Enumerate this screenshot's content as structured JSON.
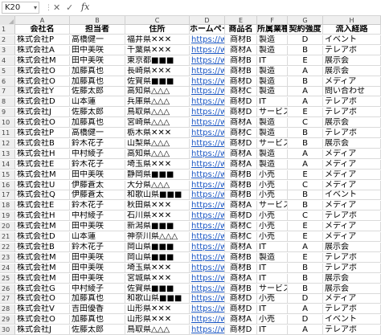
{
  "formula_bar": {
    "name_box": "K20",
    "cancel_icon": "✕",
    "enter_icon": "✓",
    "fx": "fx",
    "value": ""
  },
  "columns": [
    "A",
    "B",
    "C",
    "D",
    "E",
    "F",
    "G",
    "H"
  ],
  "header_row": [
    "会社名",
    "担当者",
    "住所",
    "ホームページ",
    "商品名",
    "所属業種",
    "契約強度",
    "流入経路"
  ],
  "rows": [
    [
      "株式会社P",
      "高橋健一",
      "福井県✕✕✕",
      "https://ww",
      "商材B",
      "製造",
      "D",
      "イベント"
    ],
    [
      "株式会社A",
      "田中美咲",
      "千葉県✕✕✕",
      "https://ww",
      "商材A",
      "製造",
      "B",
      "テレアポ"
    ],
    [
      "株式会社M",
      "田中美咲",
      "東京都■■■",
      "https://ww",
      "商材B",
      "IT",
      "E",
      "展示会"
    ],
    [
      "株式会社O",
      "加藤真也",
      "長崎県✕✕✕",
      "https://ww",
      "商材B",
      "製造",
      "A",
      "展示会"
    ],
    [
      "株式会社O",
      "加藤真也",
      "佐賀県■■■",
      "https://ww",
      "商材D",
      "製造",
      "B",
      "メディア"
    ],
    [
      "株式会社Y",
      "佐藤太郎",
      "高知県△△△",
      "https://ww",
      "商材C",
      "製造",
      "A",
      "問い合わせ"
    ],
    [
      "株式会社D",
      "山本蓮",
      "兵庫県△△△",
      "https://ww",
      "商材D",
      "IT",
      "A",
      "テレアポ"
    ],
    [
      "株式会社J",
      "佐藤太郎",
      "鳥取県△△△",
      "https://ww",
      "商材D",
      "サービス",
      "E",
      "テレアポ"
    ],
    [
      "株式会社O",
      "加藤真也",
      "宮崎県△△△",
      "https://ww",
      "商材A",
      "製造",
      "C",
      "展示会"
    ],
    [
      "株式会社P",
      "高橋健一",
      "栃木県✕✕✕",
      "https://ww",
      "商材C",
      "製造",
      "B",
      "テレアポ"
    ],
    [
      "株式会社B",
      "鈴木花子",
      "山梨県△△△",
      "https://ww",
      "商材D",
      "サービス",
      "B",
      "展示会"
    ],
    [
      "株式会社H",
      "中村綾子",
      "高知県△△△",
      "https://ww",
      "商材A",
      "製造",
      "A",
      "メディア"
    ],
    [
      "株式会社E",
      "鈴木花子",
      "埼玉県✕✕✕",
      "https://ww",
      "商材A",
      "製造",
      "A",
      "メディア"
    ],
    [
      "株式会社M",
      "田中美咲",
      "静岡県■■■",
      "https://ww",
      "商材B",
      "小売",
      "E",
      "メディア"
    ],
    [
      "株式会社U",
      "伊藤蒼太",
      "大分県△△△",
      "https://ww",
      "商材B",
      "小売",
      "C",
      "メディア"
    ],
    [
      "株式会社Q",
      "伊藤蒼太",
      "和歌山県■■■",
      "https://ww",
      "商材B",
      "小売",
      "B",
      "イベント"
    ],
    [
      "株式会社E",
      "鈴木花子",
      "秋田県✕✕✕",
      "https://ww",
      "商材A",
      "サービス",
      "B",
      "メディア"
    ],
    [
      "株式会社H",
      "中村綾子",
      "石川県✕✕✕",
      "https://ww",
      "商材D",
      "小売",
      "C",
      "テレアポ"
    ],
    [
      "株式会社M",
      "田中美咲",
      "新潟県■■■",
      "https://ww",
      "商材C",
      "小売",
      "E",
      "メディア"
    ],
    [
      "株式会社D",
      "山本蓮",
      "神奈川県△△△",
      "https://ww",
      "商材C",
      "小売",
      "E",
      "メディア"
    ],
    [
      "株式会社B",
      "鈴木花子",
      "岡山県■■■",
      "https://ww",
      "商材A",
      "IT",
      "A",
      "展示会"
    ],
    [
      "株式会社M",
      "田中美咲",
      "岡山県■■■",
      "https://ww",
      "商材B",
      "製造",
      "E",
      "テレアポ"
    ],
    [
      "株式会社M",
      "田中美咲",
      "埼玉県✕✕✕",
      "https://ww",
      "商材B",
      "IT",
      "B",
      "テレアポ"
    ],
    [
      "株式会社M",
      "田中美咲",
      "宮城県✕✕✕",
      "https://ww",
      "商材A",
      "IT",
      "B",
      "展示会"
    ],
    [
      "株式会社G",
      "中村綾子",
      "佐賀県■■■",
      "https://ww",
      "商材B",
      "サービス",
      "B",
      "展示会"
    ],
    [
      "株式会社O",
      "加藤真也",
      "和歌山県■■■",
      "https://ww",
      "商材D",
      "小売",
      "D",
      "メディア"
    ],
    [
      "株式会社V",
      "吉田優香",
      "山形県✕✕✕",
      "https://ww",
      "商材D",
      "IT",
      "A",
      "テレアポ"
    ],
    [
      "株式会社O",
      "加藤真也",
      "山形県✕✕✕",
      "https://ww",
      "商材A",
      "小売",
      "D",
      "イベント"
    ],
    [
      "株式会社J",
      "佐藤太郎",
      "鳥取県△△△",
      "https://ww",
      "商材D",
      "IT",
      "A",
      "テレアポ"
    ]
  ],
  "colors": {
    "link": "#1a56c4",
    "selection": "#1e7145",
    "header_bg": "#efefef"
  }
}
